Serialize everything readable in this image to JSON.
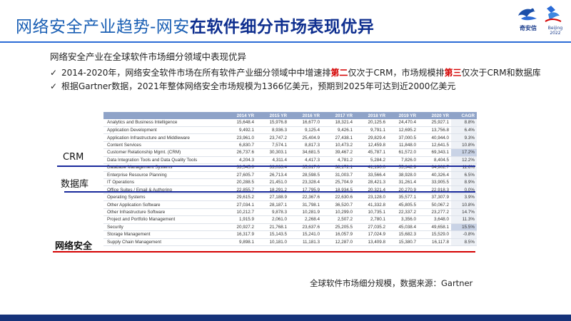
{
  "title": {
    "normal": "网络安全产业趋势-网安",
    "bold": "在软件细分市场表现优异"
  },
  "logo": {
    "brand": "奇安信",
    "partner": "Beijing 2022"
  },
  "intro": "网络安全产业在全球软件市场细分领域中表现优异",
  "bullets": [
    {
      "mark": "✓",
      "parts": [
        {
          "text": "2014-2020年，网络安全软件市场在所有软件产业细分领域中中增速排",
          "red": false
        },
        {
          "text": "第二",
          "red": true
        },
        {
          "text": "仅次于CRM，市场规模排",
          "red": false
        },
        {
          "text": "第三",
          "red": true
        },
        {
          "text": "仅次于CRM和数据库",
          "red": false
        }
      ]
    },
    {
      "mark": "✓",
      "parts": [
        {
          "text": "根据Gartner数据，2021年整体网络安全市场规模为1366亿美元，预期到2025年可达到近2000亿美元",
          "red": false
        }
      ]
    }
  ],
  "table": {
    "headers": [
      "",
      "2014 YR",
      "2015 YR",
      "2016 YR",
      "2017 YR",
      "2018 YR",
      "2019 YR",
      "2020 YR",
      "CAGR"
    ],
    "rows": [
      {
        "category": "Analytics and Business Intelligence",
        "values": [
          "15,648.4",
          "15,976.8",
          "16,677.0",
          "18,321.4",
          "20,125.6",
          "24,470.4",
          "25,927.1",
          "8.8%"
        ]
      },
      {
        "category": "Application Development",
        "values": [
          "9,492.1",
          "8,936.3",
          "9,125.4",
          "9,426.1",
          "9,791.1",
          "12,695.2",
          "13,756.8",
          "6.4%"
        ]
      },
      {
        "category": "Application Infrastructure and Middleware",
        "values": [
          "23,961.0",
          "23,747.2",
          "25,404.9",
          "27,438.1",
          "29,829.4",
          "37,000.5",
          "40,944.0",
          "9.3%"
        ]
      },
      {
        "category": "Content Services",
        "values": [
          "6,830.7",
          "7,574.1",
          "8,817.3",
          "10,473.2",
          "12,459.8",
          "11,848.0",
          "12,641.5",
          "10.8%"
        ]
      },
      {
        "category": "Customer Relationship Mgmt. (CRM)",
        "values": [
          "26,737.6",
          "30,303.1",
          "34,681.5",
          "39,467.2",
          "45,787.1",
          "61,572.0",
          "69,343.1",
          "17.2%"
        ],
        "highlight": true
      },
      {
        "category": "Data Integration Tools and Data Quality Tools",
        "values": [
          "4,204.3",
          "4,311.4",
          "4,417.3",
          "4,781.2",
          "5,284.2",
          "7,826.0",
          "8,404.5",
          "12.2%"
        ]
      },
      {
        "category": "Database Management Systems",
        "values": [
          "33,545.0",
          "33,033.4",
          "35,617.0",
          "38,172.1",
          "41,190.0",
          "55,342.9",
          "64,902.7",
          "11.6%"
        ]
      },
      {
        "category": "Enterprise Resource Planning",
        "values": [
          "27,605.7",
          "26,713.4",
          "28,598.5",
          "31,003.7",
          "33,566.4",
          "38,928.0",
          "40,326.4",
          "6.5%"
        ]
      },
      {
        "category": "IT Operations",
        "values": [
          "20,288.5",
          "21,451.0",
          "23,328.4",
          "25,704.9",
          "28,421.3",
          "31,261.4",
          "33,905.5",
          "8.9%"
        ]
      },
      {
        "category": "Office Suites / Email & Authoring",
        "values": [
          "22,855.7",
          "18,291.2",
          "17,795.9",
          "18,934.5",
          "20,321.4",
          "20,270.9",
          "22,918.3",
          "0.0%"
        ]
      },
      {
        "category": "Operating Systems",
        "values": [
          "29,615.2",
          "27,188.9",
          "22,367.6",
          "22,630.6",
          "23,128.0",
          "35,577.1",
          "37,307.9",
          "3.9%"
        ]
      },
      {
        "category": "Other Application Software",
        "values": [
          "27,034.1",
          "28,187.1",
          "31,798.1",
          "36,520.7",
          "41,332.8",
          "45,805.5",
          "50,067.2",
          "10.8%"
        ]
      },
      {
        "category": "Other Infrastructure Software",
        "values": [
          "10,212.7",
          "9,878.3",
          "10,281.9",
          "10,299.0",
          "10,735.1",
          "22,337.2",
          "23,277.2",
          "14.7%"
        ]
      },
      {
        "category": "Project and Portfolio Management",
        "values": [
          "1,915.9",
          "2,061.0",
          "2,268.4",
          "2,507.2",
          "2,780.1",
          "3,356.0",
          "3,648.0",
          "11.3%"
        ]
      },
      {
        "category": "Security",
        "values": [
          "20,927.2",
          "21,768.1",
          "23,637.6",
          "25,205.5",
          "27,035.2",
          "45,038.4",
          "49,658.1",
          "15.5%"
        ],
        "highlight": true
      },
      {
        "category": "Storage Management",
        "values": [
          "16,317.9",
          "15,143.5",
          "15,241.0",
          "16,057.9",
          "17,024.9",
          "15,682.3",
          "15,529.0",
          "-0.8%"
        ]
      },
      {
        "category": "Supply Chain Management",
        "values": [
          "9,898.1",
          "10,181.0",
          "11,181.3",
          "12,287.0",
          "13,409.8",
          "15,380.7",
          "16,117.8",
          "8.5%"
        ]
      }
    ]
  },
  "labels": {
    "crm": "CRM",
    "db": "数据库",
    "security": "网络安全"
  },
  "caption": "全球软件市场细分规模，数据来源：Gartner",
  "colors": {
    "title_blue": "#1a5fb4",
    "title_bold": "#0f2f8f",
    "red": "#d40000",
    "line_blue": "#1a2a9c",
    "footer": "#16337a",
    "table_header": "#8fa3c8"
  }
}
